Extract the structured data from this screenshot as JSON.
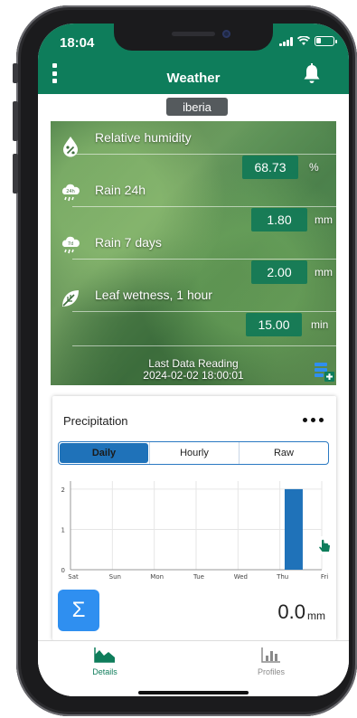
{
  "status_bar": {
    "time": "18:04",
    "battery_level": 0.3
  },
  "app_bar": {
    "title": "Weather"
  },
  "station": {
    "name": "iberia"
  },
  "sensors": [
    {
      "icon": "humidity-drop-icon",
      "label": "Relative humidity",
      "value": "68.73",
      "unit": "%"
    },
    {
      "icon": "rain-cloud-24h-icon",
      "label": "Rain 24h",
      "value": "1.80",
      "unit": "mm"
    },
    {
      "icon": "rain-cloud-7days-icon",
      "label": "Rain 7 days",
      "value": "2.00",
      "unit": "mm"
    },
    {
      "icon": "leaf-wetness-icon",
      "label": "Leaf wetness, 1 hour",
      "value": "15.00",
      "unit": "min"
    }
  ],
  "last_reading": {
    "label": "Last Data Reading",
    "timestamp": "2024-02-02 18:00:01"
  },
  "precipitation": {
    "title": "Precipitation",
    "tabs": [
      "Daily",
      "Hourly",
      "Raw"
    ],
    "active_tab": "Daily",
    "total_value": "0.0",
    "total_unit": "mm",
    "sum_symbol": "Σ"
  },
  "chart_data": {
    "type": "bar",
    "categories": [
      "Sat",
      "Sun",
      "Mon",
      "Tue",
      "Wed",
      "Thu",
      "Fri"
    ],
    "values": [
      0,
      0,
      0,
      0,
      0,
      2,
      0
    ],
    "bar_position": "Thu",
    "yticks": [
      "0",
      "1",
      "2"
    ],
    "ylim": [
      0,
      2.2
    ],
    "grid": true,
    "bar_color": "#1f72b9"
  },
  "tabbar": {
    "tabs": [
      {
        "label": "Details",
        "active": true
      },
      {
        "label": "Profiles",
        "active": false
      }
    ]
  },
  "colors": {
    "primary": "#0e7d5b",
    "accent": "#1f72b9",
    "sum_button": "#2f8ff0"
  }
}
